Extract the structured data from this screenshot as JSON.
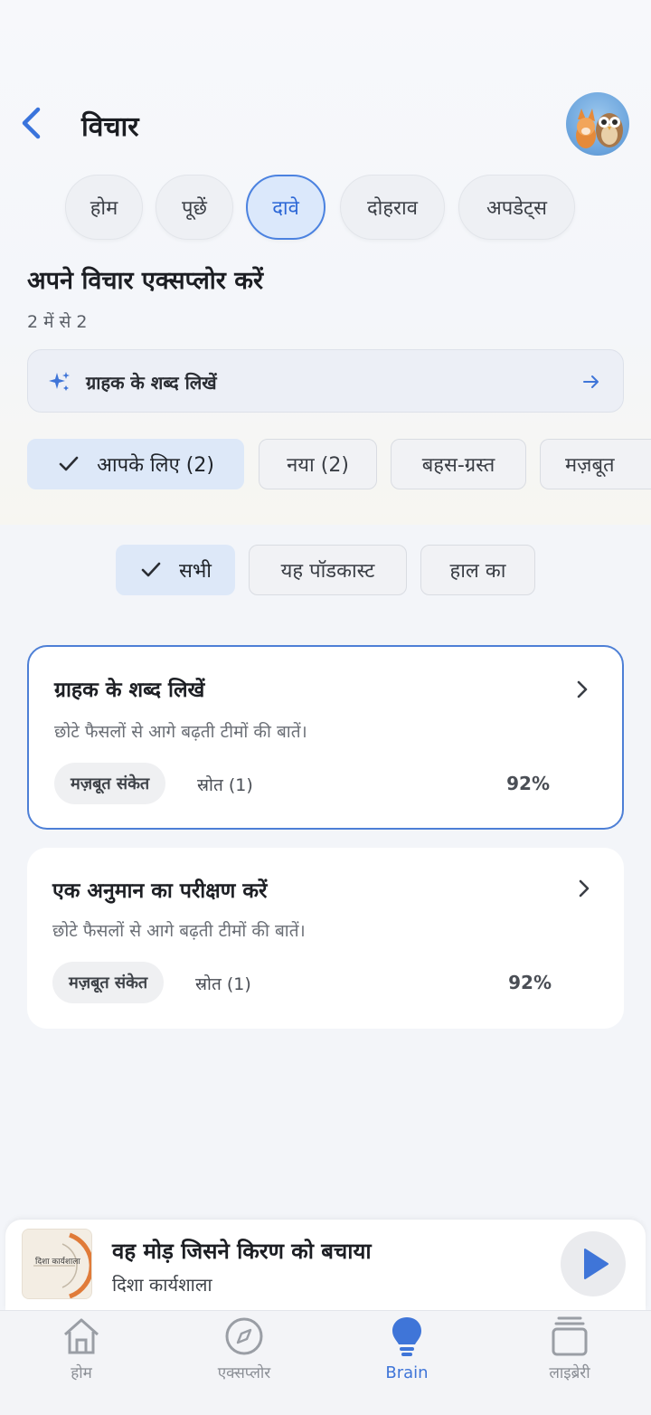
{
  "header": {
    "title": "विचार"
  },
  "tabs": [
    "होम",
    "पूछें",
    "दावे",
    "दोहराव",
    "अपडेट्स"
  ],
  "active_tab": "दावे",
  "section": {
    "title": "अपने विचार एक्सप्लोर करें",
    "count": "2 में से 2"
  },
  "search": {
    "text": "ग्राहक के शब्द लिखें"
  },
  "filters": [
    "आपके लिए (2)",
    "नया (2)",
    "बहस-ग्रस्त",
    "मज़बूत"
  ],
  "scope": [
    "सभी",
    "यह पॉडकास्ट",
    "हाल का"
  ],
  "cards": [
    {
      "title": "ग्राहक के शब्द लिखें",
      "desc": "छोटे फैसलों से आगे बढ़ती टीमों की बातें।",
      "badge": "मज़बूत संकेत",
      "source": "स्रोत (1)",
      "percent": "92%"
    },
    {
      "title": "एक अनुमान का परीक्षण करें",
      "desc": "छोटे फैसलों से आगे बढ़ती टीमों की बातें।",
      "badge": "मज़बूत संकेत",
      "source": "स्रोत (1)",
      "percent": "92%"
    }
  ],
  "player": {
    "title": "वह मोड़ जिसने किरण को बचाया",
    "subtitle": "दिशा कार्यशाला",
    "cover_text": "दिशा कार्यशाला"
  },
  "nav": [
    "होम",
    "एक्सप्लोर",
    "Brain",
    "लाइब्रेरी"
  ],
  "colors": {
    "accent": "#3f75d8",
    "active_border": "#4d7fd6",
    "chip_selected": "#dde8f8",
    "background": "#f3f5f9"
  },
  "icons": [
    "back-arrow-icon",
    "sparkle-icon",
    "arrow-right-icon",
    "check-icon",
    "chevron-right-icon",
    "play-icon",
    "home-icon",
    "compass-icon",
    "lightbulb-icon",
    "library-icon"
  ]
}
